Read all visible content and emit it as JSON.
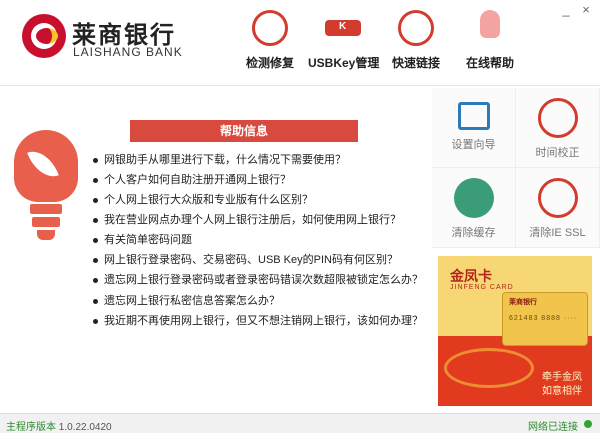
{
  "app": {
    "bank_name_cn": "莱商银行",
    "bank_name_en": "LAISHANG BANK",
    "window_controls": {
      "minimize": "_",
      "close": "×"
    }
  },
  "nav": {
    "items": [
      {
        "label": "检测修复",
        "icon": "monitor-repair-icon"
      },
      {
        "label": "USBKey管理",
        "icon": "usb-key-icon"
      },
      {
        "label": "快速链接",
        "icon": "link-icon"
      },
      {
        "label": "在线帮助",
        "icon": "lightbulb-icon"
      }
    ]
  },
  "help": {
    "title": "帮助信息",
    "items": [
      "网银助手从哪里进行下载，什么情况下需要使用？",
      "个人客户如何自助注册开通网上银行？",
      "个人网上银行大众版和专业版有什么区别？",
      "我在营业网点办理个人网上银行注册后，如何使用网上银行？",
      "有关简单密码问题",
      "网上银行登录密码、交易密码、USB Key的PIN码有何区别？",
      "遗忘网上银行登录密码或者登录密码错误次数超限被锁定怎么办？",
      "遗忘网上银行私密信息答案怎么办？",
      "我近期不再使用网上银行，但又不想注销网上银行，该如何办理？"
    ]
  },
  "tools": [
    {
      "label": "设置向导",
      "icon": "setup-wizard-icon"
    },
    {
      "label": "时间校正",
      "icon": "clock-icon"
    },
    {
      "label": "清除缓存",
      "icon": "globe-icon"
    },
    {
      "label": "清除IE SSL",
      "icon": "brush-icon"
    }
  ],
  "ad": {
    "title": "金凤卡",
    "subtitle": "JINFENG CARD",
    "card_bank": "莱商银行",
    "card_number": "621483 8888 ····",
    "slogan_line1": "牵手金凤",
    "slogan_line2": "如意相伴"
  },
  "status": {
    "version_label": "主程序版本",
    "version": "1.0.22.0420",
    "network": "网络已连接"
  },
  "colors": {
    "accent": "#d94a3e",
    "brand_red": "#c8102e",
    "status_green": "#2f8a2f"
  }
}
